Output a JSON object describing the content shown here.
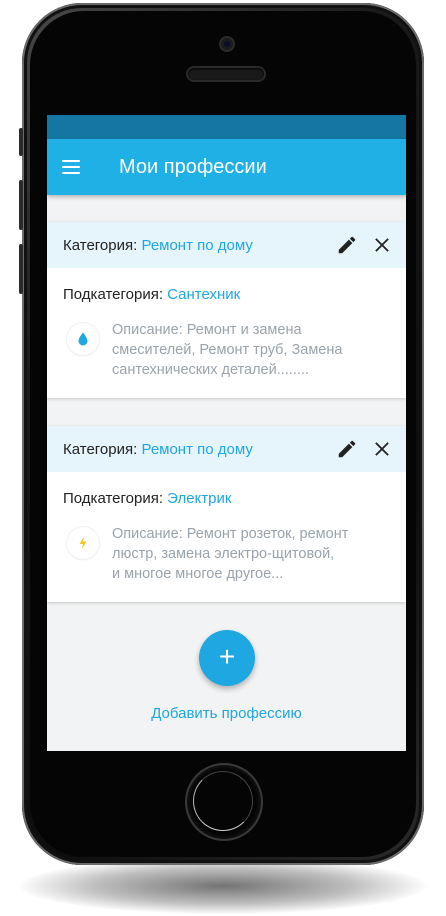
{
  "app": {
    "title": "Мои профессии"
  },
  "colors": {
    "accent": "#1ea7e0",
    "appbar": "#1fb0e6",
    "statusbar": "#1576a3",
    "card_header": "#e6f5fc",
    "description": "#9aa3ab"
  },
  "icons": {
    "menu": "menu-icon",
    "edit": "pencil-icon",
    "close": "close-icon",
    "fab": "plus-icon"
  },
  "professions": [
    {
      "category_label": "Категория: ",
      "category_value": "Ремонт по дому",
      "subcategory_label": "Подкатегория: ",
      "subcategory_value": "Сантехник",
      "icon": "water-drop-icon",
      "description_lines": [
        "Описание: Ремонт и замена",
        "смесителей, Ремонт труб, Замена",
        "сантехнических деталей........"
      ]
    },
    {
      "category_label": "Категория: ",
      "category_value": "Ремонт по дому",
      "subcategory_label": "Подкатегория: ",
      "subcategory_value": "Электрик",
      "icon": "lightning-icon",
      "description_lines": [
        "Описание: Ремонт розеток, ремонт",
        "люстр, замена электро-щитовой,",
        "и многое многое другое..."
      ]
    }
  ],
  "fab": {
    "symbol": "+"
  },
  "add_profession_label": "Добавить профессию"
}
